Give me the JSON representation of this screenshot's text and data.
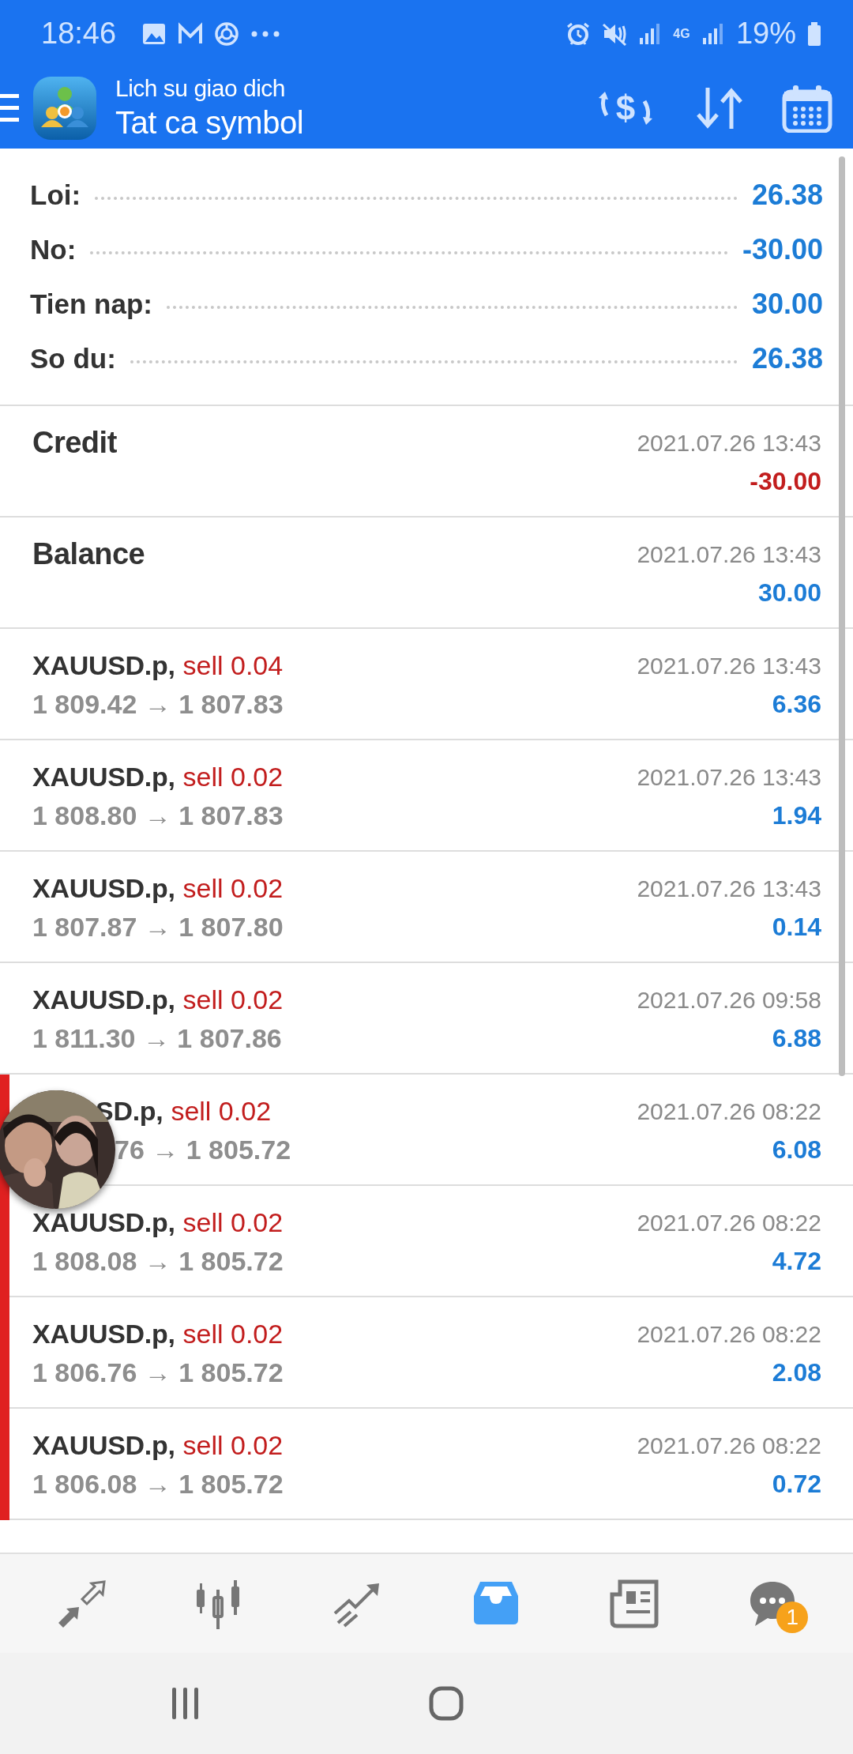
{
  "status_bar": {
    "time": "18:46",
    "network": "4G",
    "battery": "19%"
  },
  "header": {
    "subtitle": "Lich su giao dich",
    "title": "Tat ca symbol",
    "currency_symbol": "$"
  },
  "summary": [
    {
      "label": "Loi:",
      "value": "26.38"
    },
    {
      "label": "No:",
      "value": "-30.00"
    },
    {
      "label": "Tien nap:",
      "value": "30.00"
    },
    {
      "label": "So du:",
      "value": "26.38"
    }
  ],
  "deals": [
    {
      "kind": "balance",
      "label": "Credit",
      "time": "2021.07.26 13:43",
      "amount": "-30.00",
      "negative": true,
      "flagged": false
    },
    {
      "kind": "balance",
      "label": "Balance",
      "time": "2021.07.26 13:43",
      "amount": "30.00",
      "negative": false,
      "flagged": false
    },
    {
      "kind": "trade",
      "symbol": "XAUUSD.p,",
      "side": "sell 0.04",
      "prices": "1 809.42 → 1 807.83",
      "time": "2021.07.26 13:43",
      "amount": "6.36",
      "negative": false,
      "flagged": false,
      "covered": false
    },
    {
      "kind": "trade",
      "symbol": "XAUUSD.p,",
      "side": "sell 0.02",
      "prices": "1 808.80 → 1 807.83",
      "time": "2021.07.26 13:43",
      "amount": "1.94",
      "negative": false,
      "flagged": false,
      "covered": false
    },
    {
      "kind": "trade",
      "symbol": "XAUUSD.p,",
      "side": "sell 0.02",
      "prices": "1 807.87 → 1 807.80",
      "time": "2021.07.26 13:43",
      "amount": "0.14",
      "negative": false,
      "flagged": false,
      "covered": false
    },
    {
      "kind": "trade",
      "symbol": "XAUUSD.p,",
      "side": "sell 0.02",
      "prices": "1 811.30 → 1 807.86",
      "time": "2021.07.26 09:58",
      "amount": "6.88",
      "negative": false,
      "flagged": false,
      "covered": false
    },
    {
      "kind": "trade",
      "symbol": "SD.p,",
      "side": "sell 0.02",
      "prices": "76 → 1 805.72",
      "time": "2021.07.26 08:22",
      "amount": "6.08",
      "negative": false,
      "flagged": true,
      "covered": true
    },
    {
      "kind": "trade",
      "symbol": "XAUUSD.p,",
      "side": "sell 0.02",
      "prices": "1 808.08 → 1 805.72",
      "time": "2021.07.26 08:22",
      "amount": "4.72",
      "negative": false,
      "flagged": true,
      "covered": false
    },
    {
      "kind": "trade",
      "symbol": "XAUUSD.p,",
      "side": "sell 0.02",
      "prices": "1 806.76 → 1 805.72",
      "time": "2021.07.26 08:22",
      "amount": "2.08",
      "negative": false,
      "flagged": true,
      "covered": false
    },
    {
      "kind": "trade",
      "symbol": "XAUUSD.p,",
      "side": "sell 0.02",
      "prices": "1 806.08 → 1 805.72",
      "time": "2021.07.26 08:22",
      "amount": "0.72",
      "negative": false,
      "flagged": true,
      "covered": false
    }
  ],
  "bottom_nav": {
    "items": [
      {
        "kind": "quotes",
        "selected": false
      },
      {
        "kind": "chart",
        "selected": false
      },
      {
        "kind": "trade",
        "selected": false
      },
      {
        "kind": "history",
        "selected": true
      },
      {
        "kind": "news",
        "selected": false
      },
      {
        "kind": "chat",
        "selected": false,
        "badge": "1"
      }
    ]
  }
}
